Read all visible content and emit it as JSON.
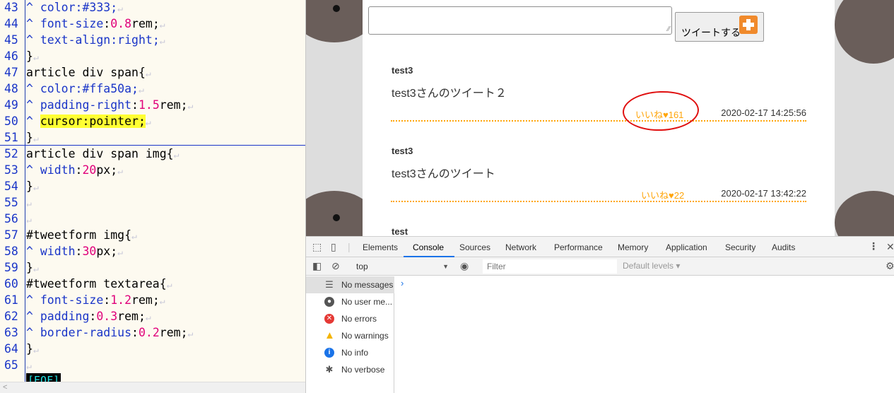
{
  "editor": {
    "lines": [
      {
        "n": "43",
        "tab": "^ ",
        "prop": "color",
        "rest": ":#333;"
      },
      {
        "n": "44",
        "tab": "^ ",
        "prop": "font-size",
        "num": "0.8",
        "unit": "rem;"
      },
      {
        "n": "45",
        "tab": "^ ",
        "prop": "text-align",
        "rest": ":right;"
      },
      {
        "n": "46",
        "plain": "}"
      },
      {
        "n": "47",
        "plain": "article div span{"
      },
      {
        "n": "48",
        "tab": "^ ",
        "prop": "color",
        "rest": ":#ffa50a;"
      },
      {
        "n": "49",
        "tab": "^ ",
        "prop": "padding-right",
        "num": "1.5",
        "unit": "rem;"
      },
      {
        "n": "50",
        "tab": "^ ",
        "highlight": "cursor:pointer;"
      },
      {
        "n": "51",
        "plain": "}"
      },
      {
        "n": "52",
        "plain": "article div span img{"
      },
      {
        "n": "53",
        "tab": "^ ",
        "prop": "width",
        "num": "20",
        "unit": "px;"
      },
      {
        "n": "54",
        "plain": "}"
      },
      {
        "n": "55",
        "plain": ""
      },
      {
        "n": "56",
        "plain": ""
      },
      {
        "n": "57",
        "plain": "#tweetform img{"
      },
      {
        "n": "58",
        "tab": "^ ",
        "prop": "width",
        "num": "30",
        "unit": "px;"
      },
      {
        "n": "59",
        "plain": "}"
      },
      {
        "n": "60",
        "plain": "#tweetform textarea{"
      },
      {
        "n": "61",
        "tab": "^ ",
        "prop": "font-size",
        "num": "1.2",
        "unit": "rem;"
      },
      {
        "n": "62",
        "tab": "^ ",
        "prop": "padding",
        "num": "0.3",
        "unit": "rem;"
      },
      {
        "n": "63",
        "tab": "^ ",
        "prop": "border-radius",
        "num": "0.2",
        "unit": "rem;"
      },
      {
        "n": "64",
        "plain": "}"
      },
      {
        "n": "65",
        "plain": ""
      }
    ],
    "eof": "[EOF]",
    "eol_mark": "↵"
  },
  "page": {
    "tweet_button_label": "ツイートする",
    "articles": [
      {
        "user": "test3",
        "text": "test3さんのツイート２",
        "like": "いいね♥161",
        "date": "2020-02-17 14:25:56"
      },
      {
        "user": "test3",
        "text": "test3さんのツイート",
        "like": "いいね♥22",
        "date": "2020-02-17 13:42:22"
      },
      {
        "user": "test",
        "text": "",
        "like": "",
        "date": ""
      }
    ]
  },
  "devtools": {
    "tabs": [
      "Elements",
      "Console",
      "Sources",
      "Network",
      "Performance",
      "Memory",
      "Application",
      "Security",
      "Audits"
    ],
    "active_tab": "Console",
    "context": "top",
    "filter_placeholder": "Filter",
    "levels_label": "Default levels ▾",
    "sidebar": [
      {
        "label": "No messages",
        "icon": "list-icon",
        "color": "#555555"
      },
      {
        "label": "No user me...",
        "icon": "user-icon",
        "color": "#555555"
      },
      {
        "label": "No errors",
        "icon": "error-icon",
        "color": "#e53935"
      },
      {
        "label": "No warnings",
        "icon": "warning-icon",
        "color": "#f4b400"
      },
      {
        "label": "No info",
        "icon": "info-icon",
        "color": "#1a73e8"
      },
      {
        "label": "No verbose",
        "icon": "bug-icon",
        "color": "#555555"
      }
    ],
    "prompt": "›"
  }
}
